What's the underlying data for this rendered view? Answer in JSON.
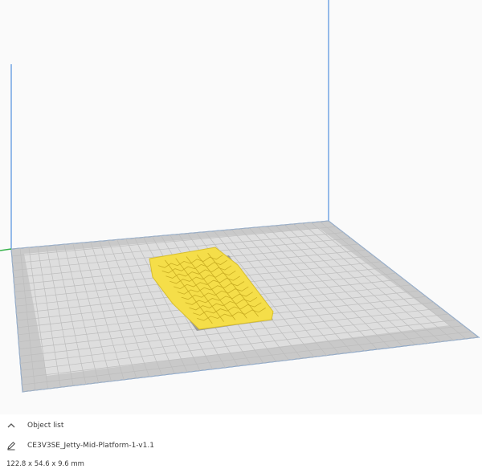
{
  "object_list": {
    "label": "Object list",
    "toggle_icon": "chevron-up-icon"
  },
  "object": {
    "name": "CE3V3SE_Jetty-Mid-Platform-1-v1.1",
    "edit_icon": "pencil-icon",
    "dimensions": "122.8 x 54.6 x 9.6 mm"
  },
  "colors": {
    "plate": "#d8d8d8",
    "plate_border": "#c3c3c3",
    "grid_line": "#bcbcbc",
    "axis_blue": "#2f7bd8",
    "axis_green": "#36b24a",
    "model_yellow": "#f7e35a",
    "model_shadow": "#8b8b8b"
  }
}
